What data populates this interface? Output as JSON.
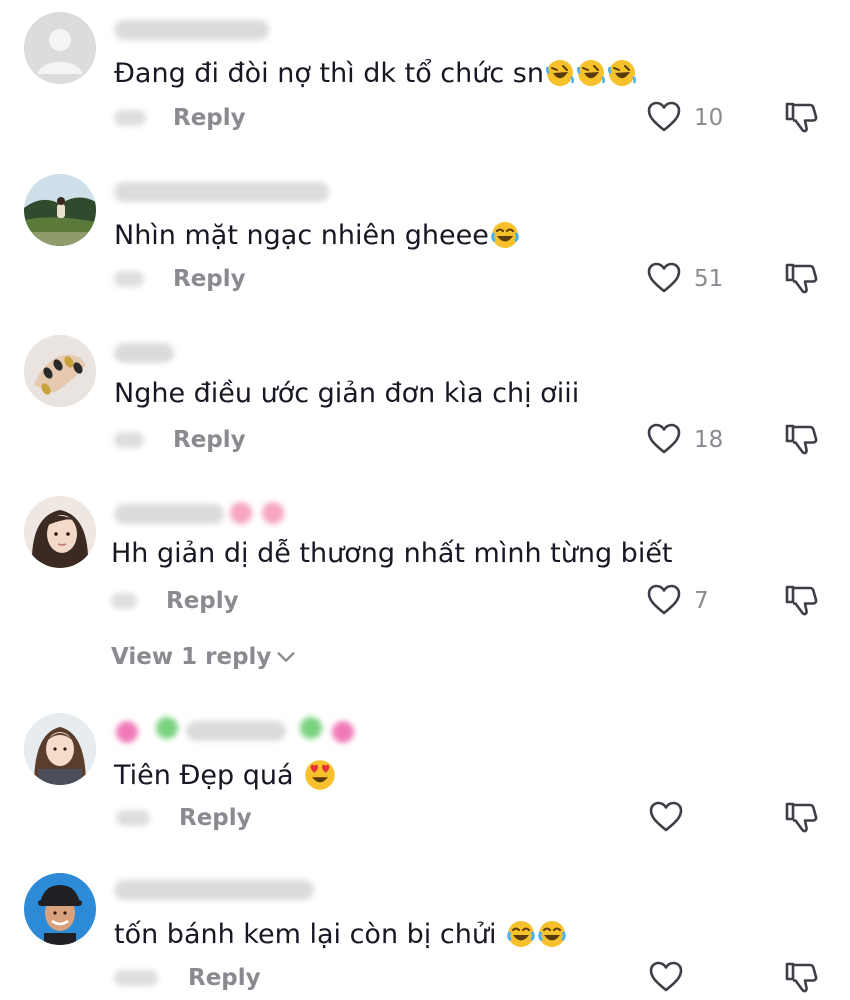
{
  "comments": [
    {
      "text": "Đang đi đòi nợ thì dk tổ chức sn",
      "emojis": [
        "rofl-emoji",
        "rofl-emoji",
        "rofl-emoji"
      ],
      "reply_label": "Reply",
      "likes": "10"
    },
    {
      "text": "Nhìn mặt ngạc nhiên gheee",
      "emojis": [
        "joy-emoji"
      ],
      "reply_label": "Reply",
      "likes": "51"
    },
    {
      "text": "Nghe điều ước giản đơn kìa chị ơiii",
      "emojis": [],
      "reply_label": "Reply",
      "likes": "18"
    },
    {
      "text": "Hh giản dị dễ thương nhất mình từng biết",
      "emojis": [],
      "reply_label": "Reply",
      "likes": "7"
    },
    {
      "text": "Tiên Đẹp quá",
      "emojis": [
        "heart-eyes-emoji"
      ],
      "reply_label": "Reply",
      "likes": ""
    },
    {
      "text": "tốn bánh kem lại còn bị chửi",
      "emojis": [
        "joy-emoji",
        "joy-emoji"
      ],
      "reply_label": "Reply",
      "likes": ""
    }
  ],
  "view_replies_label": "View 1 reply",
  "icons": {
    "like": "heart-outline-icon",
    "dislike": "thumbs-down-icon",
    "expand": "chevron-down-icon"
  },
  "colors": {
    "text": "#161823",
    "muted": "#8a8b91",
    "background": "#ffffff"
  }
}
